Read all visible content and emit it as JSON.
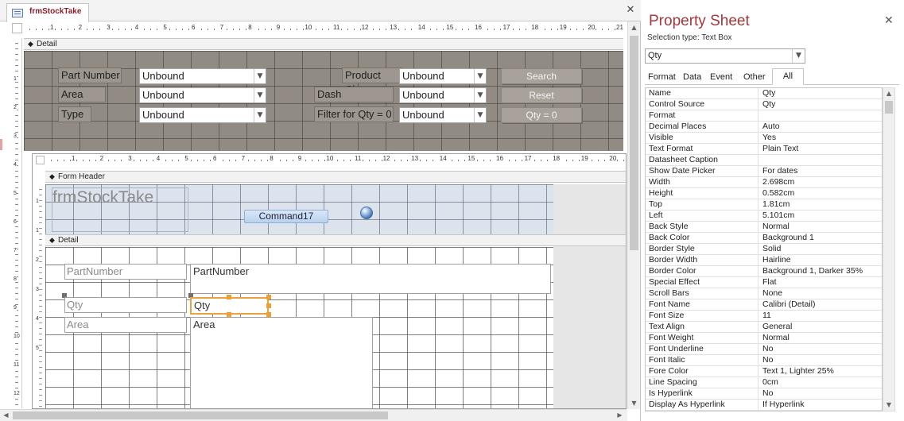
{
  "document": {
    "tab_label": "frmStockTake",
    "close_glyph": "✕"
  },
  "ruler": {
    "numbers": [
      "1",
      "2",
      "3",
      "4",
      "5",
      "6",
      "7",
      "8",
      "9",
      "10",
      "11",
      "12",
      "13",
      "14",
      "15",
      "16",
      "17",
      "18",
      "19",
      "20",
      "21"
    ],
    "vertical_numbers": [
      "1",
      "2",
      "3",
      "4",
      "5",
      "6",
      "7",
      "8",
      "9",
      "10",
      "11",
      "12"
    ]
  },
  "sections": {
    "detail_label": "Detail",
    "form_header_label": "Form Header",
    "sub_detail_label": "Detail"
  },
  "parent_form": {
    "labels": {
      "part_number": "Part Number",
      "area": "Area",
      "type": "Type",
      "product_class": "Product Class",
      "dash": "Dash",
      "filter_qty": "Filter for Qty = 0"
    },
    "combos": {
      "part_number": "Unbound",
      "area": "Unbound",
      "type": "Unbound",
      "product_class": "Unbound",
      "dash": "Unbound",
      "filter_qty": "Unbound"
    },
    "buttons": {
      "search": "Search",
      "reset": "Reset",
      "qty_zero": "Qty = 0"
    }
  },
  "subform": {
    "ruler_numbers": [
      "1",
      "2",
      "3",
      "4",
      "5",
      "6",
      "7",
      "8",
      "9",
      "10",
      "11",
      "12",
      "13",
      "14",
      "15",
      "16",
      "17",
      "18",
      "19",
      "20"
    ],
    "vertical_numbers": [
      "1",
      "1",
      "2",
      "3",
      "4",
      "5"
    ],
    "header_title": "frmStockTake",
    "command_button": "Command17",
    "fields": {
      "part_number_label": "PartNumber",
      "part_number_box": "PartNumber",
      "qty_label": "Qty",
      "qty_box": "Qty",
      "area_label": "Area",
      "area_box": "Area"
    }
  },
  "property_sheet": {
    "title": "Property Sheet",
    "selection_type": "Selection type:  Text Box",
    "selected_object": "Qty",
    "close_glyph": "✕",
    "tabs": [
      "Format",
      "Data",
      "Event",
      "Other",
      "All"
    ],
    "active_tab": "All",
    "properties": [
      {
        "name": "Name",
        "value": "Qty"
      },
      {
        "name": "Control Source",
        "value": "Qty"
      },
      {
        "name": "Format",
        "value": ""
      },
      {
        "name": "Decimal Places",
        "value": "Auto"
      },
      {
        "name": "Visible",
        "value": "Yes"
      },
      {
        "name": "Text Format",
        "value": "Plain Text"
      },
      {
        "name": "Datasheet Caption",
        "value": ""
      },
      {
        "name": "Show Date Picker",
        "value": "For dates"
      },
      {
        "name": "Width",
        "value": "2.698cm"
      },
      {
        "name": "Height",
        "value": "0.582cm"
      },
      {
        "name": "Top",
        "value": "1.81cm"
      },
      {
        "name": "Left",
        "value": "5.101cm"
      },
      {
        "name": "Back Style",
        "value": "Normal"
      },
      {
        "name": "Back Color",
        "value": "Background 1"
      },
      {
        "name": "Border Style",
        "value": "Solid"
      },
      {
        "name": "Border Width",
        "value": "Hairline"
      },
      {
        "name": "Border Color",
        "value": "Background 1, Darker 35%"
      },
      {
        "name": "Special Effect",
        "value": "Flat"
      },
      {
        "name": "Scroll Bars",
        "value": "None"
      },
      {
        "name": "Font Name",
        "value": "Calibri (Detail)"
      },
      {
        "name": "Font Size",
        "value": "11"
      },
      {
        "name": "Text Align",
        "value": "General"
      },
      {
        "name": "Font Weight",
        "value": "Normal"
      },
      {
        "name": "Font Underline",
        "value": "No"
      },
      {
        "name": "Font Italic",
        "value": "No"
      },
      {
        "name": "Fore Color",
        "value": "Text 1, Lighter 25%"
      },
      {
        "name": "Line Spacing",
        "value": "0cm"
      },
      {
        "name": "Is Hyperlink",
        "value": "No"
      },
      {
        "name": "Display As Hyperlink",
        "value": "If Hyperlink"
      }
    ]
  },
  "colors": {
    "title_accent": "#a4373a",
    "tab_label": "#8a1f2c",
    "selection_border": "#e8a33d",
    "parent_grid": "#918b84",
    "header_grid": "#dde3ed"
  }
}
